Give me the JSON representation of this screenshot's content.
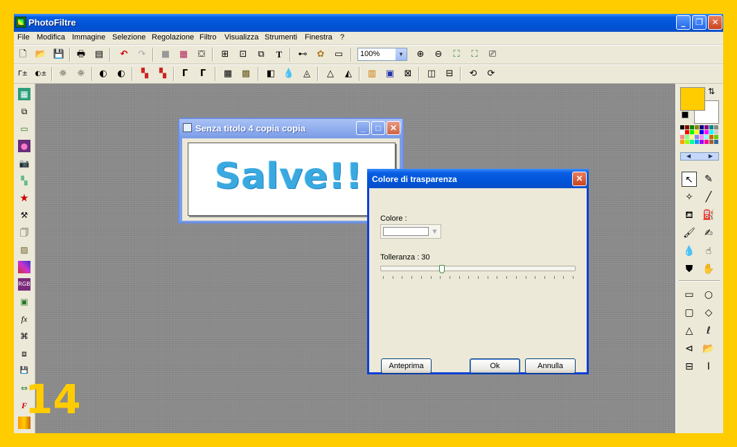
{
  "app": {
    "title": "PhotoFiltre",
    "window_buttons": {
      "minimize": "_",
      "restore": "❐",
      "close": "✕"
    }
  },
  "menu": [
    "File",
    "Modifica",
    "Immagine",
    "Selezione",
    "Regolazione",
    "Filtro",
    "Visualizza",
    "Strumenti",
    "Finestra",
    "?"
  ],
  "toolbar": {
    "zoom_value": "100%"
  },
  "image_window": {
    "title": "Senza titolo 4 copia copia",
    "image_text": "Salve!!"
  },
  "dialog": {
    "title": "Colore di trasparenza",
    "color_label": "Colore :",
    "tolerance_label": "Tolleranza : 30",
    "tolerance_value": 30,
    "buttons": {
      "preview": "Anteprima",
      "ok": "Ok",
      "cancel": "Annulla"
    },
    "close_glyph": "✕"
  },
  "colors": {
    "foreground": "#FFCC00",
    "background": "#FFFFFF",
    "frame": "#FFCC00"
  },
  "step_number": "14"
}
